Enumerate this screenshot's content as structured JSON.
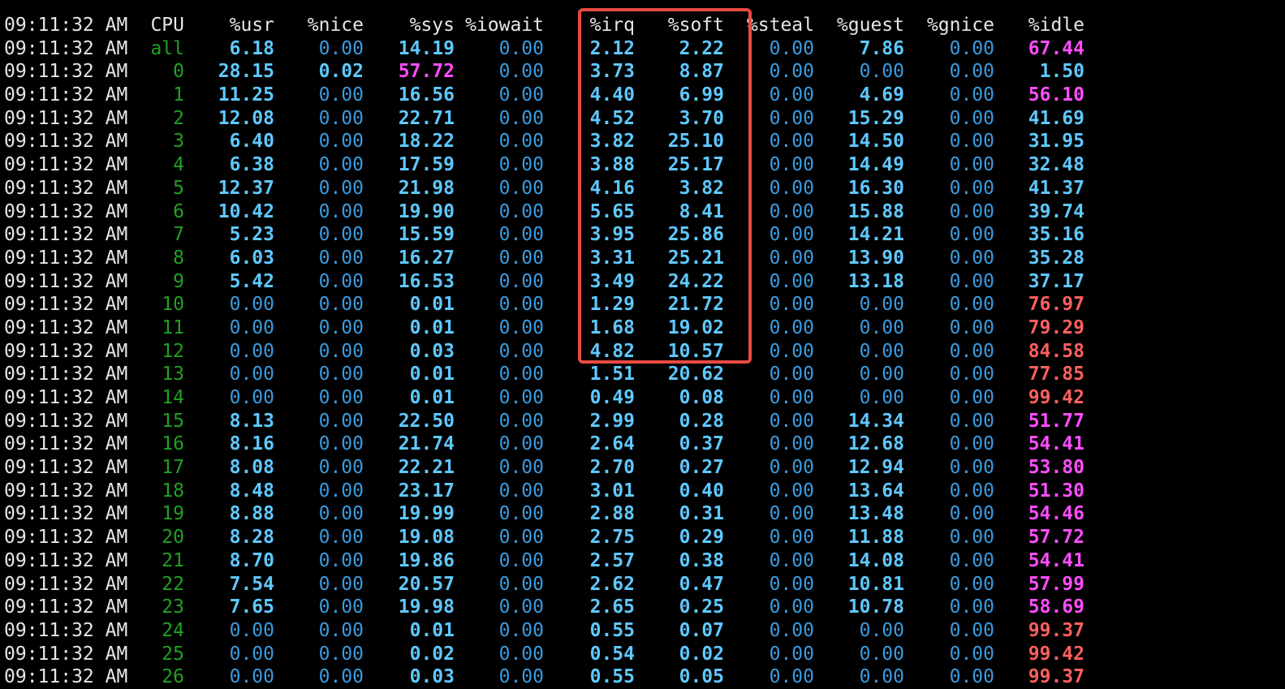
{
  "colors": {
    "background": "#000000",
    "text": "#e6e6e6",
    "cpu_id": "#21a121",
    "value_bold": "#5fc8ff",
    "value_normal": "#3a9be0",
    "magenta": "#ff4dff",
    "red": "#ff5f5f",
    "highlight_border": "#e84a42"
  },
  "header": {
    "time": "09:11:32 AM",
    "cpu": "CPU",
    "usr": "%usr",
    "nice": "%nice",
    "sys": "%sys",
    "iowait": "%iowait",
    "irq": "%irq",
    "soft": "%soft",
    "steal": "%steal",
    "guest": "%guest",
    "gnice": "%gnice",
    "idle": "%idle"
  },
  "highlight": {
    "columns": [
      "%irq",
      "%soft"
    ],
    "rows": "all through 12"
  },
  "rows": [
    {
      "time": "09:11:32 AM",
      "cpu": "all",
      "usr": "6.18",
      "nice": "0.00",
      "sys": "14.19",
      "iowait": "0.00",
      "irq": "2.12",
      "soft": "2.22",
      "steal": "0.00",
      "guest": "7.86",
      "gnice": "0.00",
      "idle": "67.44",
      "idle_color": "magenta",
      "sys_color": "bold"
    },
    {
      "time": "09:11:32 AM",
      "cpu": "0",
      "usr": "28.15",
      "nice": "0.02",
      "sys": "57.72",
      "iowait": "0.00",
      "irq": "3.73",
      "soft": "8.87",
      "steal": "0.00",
      "guest": "0.00",
      "gnice": "0.00",
      "idle": "1.50",
      "idle_color": "bold",
      "sys_color": "magenta"
    },
    {
      "time": "09:11:32 AM",
      "cpu": "1",
      "usr": "11.25",
      "nice": "0.00",
      "sys": "16.56",
      "iowait": "0.00",
      "irq": "4.40",
      "soft": "6.99",
      "steal": "0.00",
      "guest": "4.69",
      "gnice": "0.00",
      "idle": "56.10",
      "idle_color": "magenta",
      "sys_color": "bold"
    },
    {
      "time": "09:11:32 AM",
      "cpu": "2",
      "usr": "12.08",
      "nice": "0.00",
      "sys": "22.71",
      "iowait": "0.00",
      "irq": "4.52",
      "soft": "3.70",
      "steal": "0.00",
      "guest": "15.29",
      "gnice": "0.00",
      "idle": "41.69",
      "idle_color": "bold",
      "sys_color": "bold"
    },
    {
      "time": "09:11:32 AM",
      "cpu": "3",
      "usr": "6.40",
      "nice": "0.00",
      "sys": "18.22",
      "iowait": "0.00",
      "irq": "3.82",
      "soft": "25.10",
      "steal": "0.00",
      "guest": "14.50",
      "gnice": "0.00",
      "idle": "31.95",
      "idle_color": "bold",
      "sys_color": "bold"
    },
    {
      "time": "09:11:32 AM",
      "cpu": "4",
      "usr": "6.38",
      "nice": "0.00",
      "sys": "17.59",
      "iowait": "0.00",
      "irq": "3.88",
      "soft": "25.17",
      "steal": "0.00",
      "guest": "14.49",
      "gnice": "0.00",
      "idle": "32.48",
      "idle_color": "bold",
      "sys_color": "bold"
    },
    {
      "time": "09:11:32 AM",
      "cpu": "5",
      "usr": "12.37",
      "nice": "0.00",
      "sys": "21.98",
      "iowait": "0.00",
      "irq": "4.16",
      "soft": "3.82",
      "steal": "0.00",
      "guest": "16.30",
      "gnice": "0.00",
      "idle": "41.37",
      "idle_color": "bold",
      "sys_color": "bold"
    },
    {
      "time": "09:11:32 AM",
      "cpu": "6",
      "usr": "10.42",
      "nice": "0.00",
      "sys": "19.90",
      "iowait": "0.00",
      "irq": "5.65",
      "soft": "8.41",
      "steal": "0.00",
      "guest": "15.88",
      "gnice": "0.00",
      "idle": "39.74",
      "idle_color": "bold",
      "sys_color": "bold"
    },
    {
      "time": "09:11:32 AM",
      "cpu": "7",
      "usr": "5.23",
      "nice": "0.00",
      "sys": "15.59",
      "iowait": "0.00",
      "irq": "3.95",
      "soft": "25.86",
      "steal": "0.00",
      "guest": "14.21",
      "gnice": "0.00",
      "idle": "35.16",
      "idle_color": "bold",
      "sys_color": "bold"
    },
    {
      "time": "09:11:32 AM",
      "cpu": "8",
      "usr": "6.03",
      "nice": "0.00",
      "sys": "16.27",
      "iowait": "0.00",
      "irq": "3.31",
      "soft": "25.21",
      "steal": "0.00",
      "guest": "13.90",
      "gnice": "0.00",
      "idle": "35.28",
      "idle_color": "bold",
      "sys_color": "bold"
    },
    {
      "time": "09:11:32 AM",
      "cpu": "9",
      "usr": "5.42",
      "nice": "0.00",
      "sys": "16.53",
      "iowait": "0.00",
      "irq": "3.49",
      "soft": "24.22",
      "steal": "0.00",
      "guest": "13.18",
      "gnice": "0.00",
      "idle": "37.17",
      "idle_color": "bold",
      "sys_color": "bold"
    },
    {
      "time": "09:11:32 AM",
      "cpu": "10",
      "usr": "0.00",
      "nice": "0.00",
      "sys": "0.01",
      "iowait": "0.00",
      "irq": "1.29",
      "soft": "21.72",
      "steal": "0.00",
      "guest": "0.00",
      "gnice": "0.00",
      "idle": "76.97",
      "idle_color": "red",
      "sys_color": "bold"
    },
    {
      "time": "09:11:32 AM",
      "cpu": "11",
      "usr": "0.00",
      "nice": "0.00",
      "sys": "0.01",
      "iowait": "0.00",
      "irq": "1.68",
      "soft": "19.02",
      "steal": "0.00",
      "guest": "0.00",
      "gnice": "0.00",
      "idle": "79.29",
      "idle_color": "red",
      "sys_color": "bold"
    },
    {
      "time": "09:11:32 AM",
      "cpu": "12",
      "usr": "0.00",
      "nice": "0.00",
      "sys": "0.03",
      "iowait": "0.00",
      "irq": "4.82",
      "soft": "10.57",
      "steal": "0.00",
      "guest": "0.00",
      "gnice": "0.00",
      "idle": "84.58",
      "idle_color": "red",
      "sys_color": "bold"
    },
    {
      "time": "09:11:32 AM",
      "cpu": "13",
      "usr": "0.00",
      "nice": "0.00",
      "sys": "0.01",
      "iowait": "0.00",
      "irq": "1.51",
      "soft": "20.62",
      "steal": "0.00",
      "guest": "0.00",
      "gnice": "0.00",
      "idle": "77.85",
      "idle_color": "red",
      "sys_color": "bold"
    },
    {
      "time": "09:11:32 AM",
      "cpu": "14",
      "usr": "0.00",
      "nice": "0.00",
      "sys": "0.01",
      "iowait": "0.00",
      "irq": "0.49",
      "soft": "0.08",
      "steal": "0.00",
      "guest": "0.00",
      "gnice": "0.00",
      "idle": "99.42",
      "idle_color": "red",
      "sys_color": "bold"
    },
    {
      "time": "09:11:32 AM",
      "cpu": "15",
      "usr": "8.13",
      "nice": "0.00",
      "sys": "22.50",
      "iowait": "0.00",
      "irq": "2.99",
      "soft": "0.28",
      "steal": "0.00",
      "guest": "14.34",
      "gnice": "0.00",
      "idle": "51.77",
      "idle_color": "magenta",
      "sys_color": "bold"
    },
    {
      "time": "09:11:32 AM",
      "cpu": "16",
      "usr": "8.16",
      "nice": "0.00",
      "sys": "21.74",
      "iowait": "0.00",
      "irq": "2.64",
      "soft": "0.37",
      "steal": "0.00",
      "guest": "12.68",
      "gnice": "0.00",
      "idle": "54.41",
      "idle_color": "magenta",
      "sys_color": "bold"
    },
    {
      "time": "09:11:32 AM",
      "cpu": "17",
      "usr": "8.08",
      "nice": "0.00",
      "sys": "22.21",
      "iowait": "0.00",
      "irq": "2.70",
      "soft": "0.27",
      "steal": "0.00",
      "guest": "12.94",
      "gnice": "0.00",
      "idle": "53.80",
      "idle_color": "magenta",
      "sys_color": "bold"
    },
    {
      "time": "09:11:32 AM",
      "cpu": "18",
      "usr": "8.48",
      "nice": "0.00",
      "sys": "23.17",
      "iowait": "0.00",
      "irq": "3.01",
      "soft": "0.40",
      "steal": "0.00",
      "guest": "13.64",
      "gnice": "0.00",
      "idle": "51.30",
      "idle_color": "magenta",
      "sys_color": "bold"
    },
    {
      "time": "09:11:32 AM",
      "cpu": "19",
      "usr": "8.88",
      "nice": "0.00",
      "sys": "19.99",
      "iowait": "0.00",
      "irq": "2.88",
      "soft": "0.31",
      "steal": "0.00",
      "guest": "13.48",
      "gnice": "0.00",
      "idle": "54.46",
      "idle_color": "magenta",
      "sys_color": "bold"
    },
    {
      "time": "09:11:32 AM",
      "cpu": "20",
      "usr": "8.28",
      "nice": "0.00",
      "sys": "19.08",
      "iowait": "0.00",
      "irq": "2.75",
      "soft": "0.29",
      "steal": "0.00",
      "guest": "11.88",
      "gnice": "0.00",
      "idle": "57.72",
      "idle_color": "magenta",
      "sys_color": "bold"
    },
    {
      "time": "09:11:32 AM",
      "cpu": "21",
      "usr": "8.70",
      "nice": "0.00",
      "sys": "19.86",
      "iowait": "0.00",
      "irq": "2.57",
      "soft": "0.38",
      "steal": "0.00",
      "guest": "14.08",
      "gnice": "0.00",
      "idle": "54.41",
      "idle_color": "magenta",
      "sys_color": "bold"
    },
    {
      "time": "09:11:32 AM",
      "cpu": "22",
      "usr": "7.54",
      "nice": "0.00",
      "sys": "20.57",
      "iowait": "0.00",
      "irq": "2.62",
      "soft": "0.47",
      "steal": "0.00",
      "guest": "10.81",
      "gnice": "0.00",
      "idle": "57.99",
      "idle_color": "magenta",
      "sys_color": "bold"
    },
    {
      "time": "09:11:32 AM",
      "cpu": "23",
      "usr": "7.65",
      "nice": "0.00",
      "sys": "19.98",
      "iowait": "0.00",
      "irq": "2.65",
      "soft": "0.25",
      "steal": "0.00",
      "guest": "10.78",
      "gnice": "0.00",
      "idle": "58.69",
      "idle_color": "magenta",
      "sys_color": "bold"
    },
    {
      "time": "09:11:32 AM",
      "cpu": "24",
      "usr": "0.00",
      "nice": "0.00",
      "sys": "0.01",
      "iowait": "0.00",
      "irq": "0.55",
      "soft": "0.07",
      "steal": "0.00",
      "guest": "0.00",
      "gnice": "0.00",
      "idle": "99.37",
      "idle_color": "red",
      "sys_color": "bold"
    },
    {
      "time": "09:11:32 AM",
      "cpu": "25",
      "usr": "0.00",
      "nice": "0.00",
      "sys": "0.02",
      "iowait": "0.00",
      "irq": "0.54",
      "soft": "0.02",
      "steal": "0.00",
      "guest": "0.00",
      "gnice": "0.00",
      "idle": "99.42",
      "idle_color": "red",
      "sys_color": "bold"
    },
    {
      "time": "09:11:32 AM",
      "cpu": "26",
      "usr": "0.00",
      "nice": "0.00",
      "sys": "0.03",
      "iowait": "0.00",
      "irq": "0.55",
      "soft": "0.05",
      "steal": "0.00",
      "guest": "0.00",
      "gnice": "0.00",
      "idle": "99.37",
      "idle_color": "red",
      "sys_color": "bold"
    }
  ]
}
